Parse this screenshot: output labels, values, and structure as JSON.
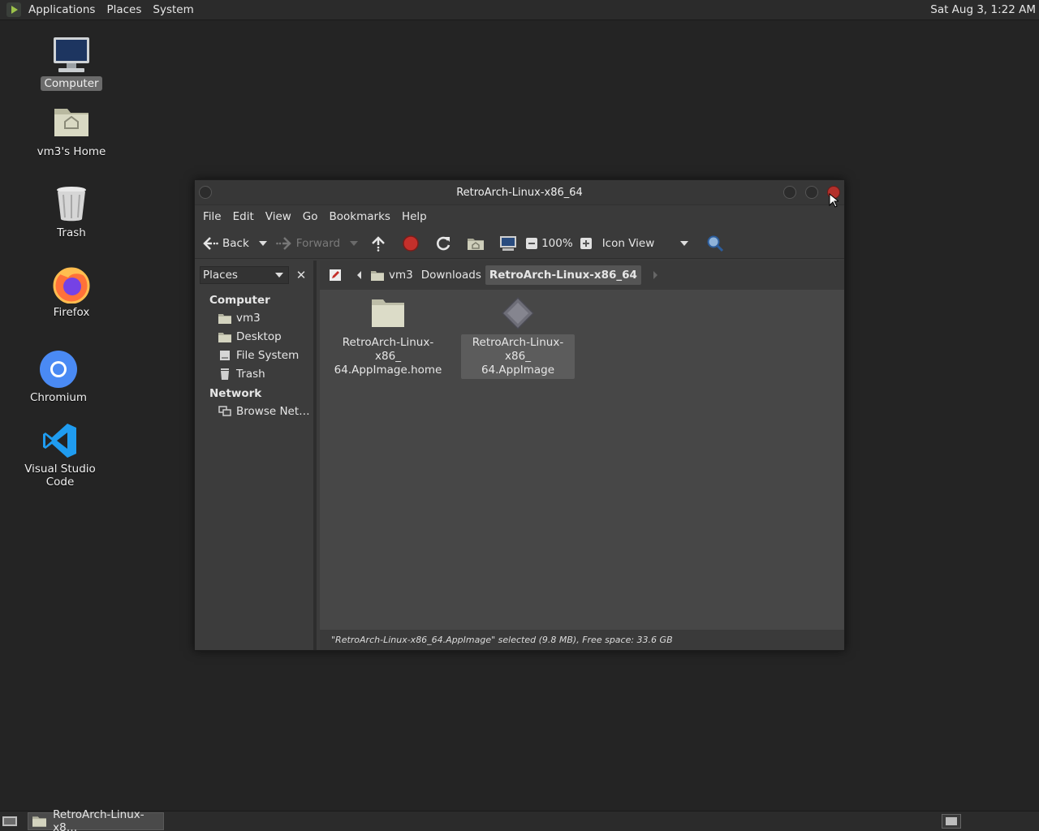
{
  "top_panel": {
    "menus": [
      "Applications",
      "Places",
      "System"
    ],
    "clock": "Sat Aug  3,  1:22 AM"
  },
  "desktop": {
    "icons": [
      {
        "label": "Computer",
        "icon": "computer-icon"
      },
      {
        "label": "vm3's Home",
        "icon": "home-folder-icon"
      },
      {
        "label": "Trash",
        "icon": "trash-icon"
      },
      {
        "label": "Firefox",
        "icon": "firefox-icon"
      },
      {
        "label": "Chromium",
        "icon": "chromium-icon"
      },
      {
        "label": "Visual Studio Code",
        "icon": "vscode-icon"
      }
    ]
  },
  "window": {
    "title": "RetroArch-Linux-x86_64",
    "menu": [
      "File",
      "Edit",
      "View",
      "Go",
      "Bookmarks",
      "Help"
    ],
    "toolbar": {
      "back": "Back",
      "forward": "Forward",
      "zoom": "100%",
      "view_mode": "Icon View"
    },
    "sidebar": {
      "combo": "Places",
      "close": "✕",
      "sections": [
        {
          "title": "Computer",
          "items": [
            "vm3",
            "Desktop",
            "File System",
            "Trash"
          ]
        },
        {
          "title": "Network",
          "items": [
            "Browse Net…"
          ]
        }
      ]
    },
    "pathbar": [
      "vm3",
      "Downloads",
      "RetroArch-Linux-x86_64"
    ],
    "files": [
      {
        "line1": "RetroArch-Linux-x86_",
        "line2": "64.AppImage.home",
        "type": "folder-icon",
        "selected": false
      },
      {
        "line1": "RetroArch-Linux-x86_",
        "line2": "64.AppImage",
        "type": "appimage-icon",
        "selected": true
      }
    ],
    "status": "\"RetroArch-Linux-x86_64.AppImage\" selected (9.8 MB), Free space: 33.6 GB"
  },
  "taskbar": {
    "task_label": "RetroArch-Linux-x8…"
  }
}
